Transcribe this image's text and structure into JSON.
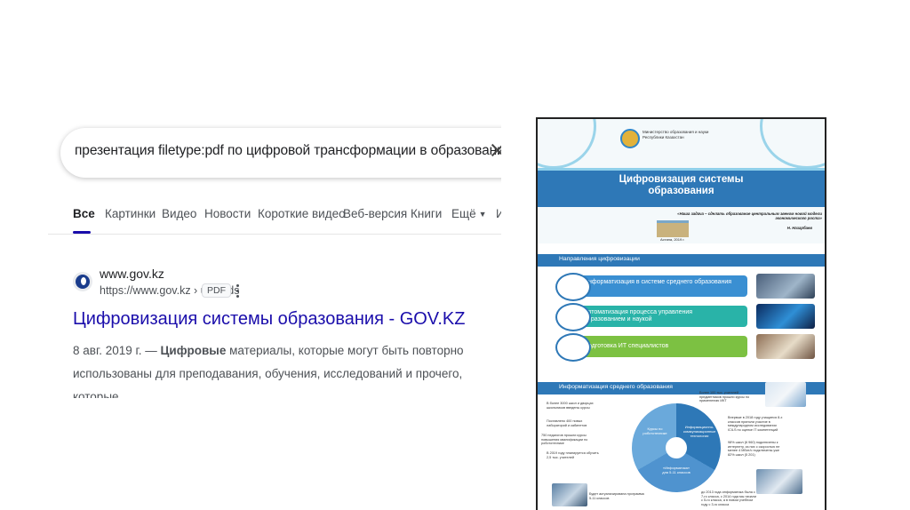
{
  "search": {
    "query": "презентация filetype:pdf по цифровой трансформации в образовании site:gov.kz",
    "tabs": [
      "Все",
      "Картинки",
      "Видео",
      "Новости",
      "Короткие видео",
      "Веб-версия",
      "Книги",
      "Ещё"
    ],
    "tab_overflow": "И"
  },
  "result": {
    "site_name": "www.gov.kz",
    "url": "https://www.gov.kz › uploads",
    "badge": "PDF",
    "title": "Цифровизация системы образования - GOV.KZ",
    "snippet_date": "8 авг. 2019 г. — ",
    "snippet_bold": "Цифровые",
    "snippet_rest": " материалы, которые могут быть повторно использованы для преподавания, обучения, исследований и прочего, которые."
  },
  "slide": {
    "ministry": "Министерство образования и науки Республики Казахстан",
    "title_line1": "Цифровизация системы",
    "title_line2": "образования",
    "quote": "«Наша задача – сделать образование центральным звеном новой модели экономического роста»",
    "author": "Н. Назарбаев",
    "city": "Астана, 2019 г.",
    "section2_header": "Направления цифровизации",
    "directions": [
      "Информатизация в системе среднего образования",
      "Автоматизация процесса управления образованием и наукой",
      "Подготовка ИТ специалистов"
    ],
    "section3_header": "Информатизация среднего образования",
    "donut_labels": [
      "Курсы по робототехнике",
      "Информационно-коммуникационные технологии",
      "«Информатика» для 5-11 классов"
    ],
    "notes_left": [
      "В более 3000 школ и дворцах школьников введены курсы",
      "Поставлено 400 новых лабораторий и кабинетов",
      "750 педагогов прошли курсы повышения квалификации по робототехнике",
      "В 2019 году планируется обучить 2,5 тыс. учителей"
    ],
    "notes_right": [
      "Более 100 тыс. учителей предметников прошли курсы по применению ИКТ",
      "Впервые в 2018 году учащиеся 8-х классов приняли участие в международном исследовании ICILS по оценке IT компетенций",
      "98% школ (6 960) подключены к интернету, из них с скоростью не менее 4 Мбит/с подключены уже 82% школ (5 201)",
      "до 2013 года информатика была с 7-го класса, с 2014 года мы начали с 5-го класса, а в новом учебном году с 3-го класса"
    ],
    "note_bottom": "Будет актуализирована программа 5-11 классов"
  },
  "colors": {
    "link": "#1a0dab",
    "slide_blue": "#2e78b7",
    "bar_blue": "#3a8fd2",
    "bar_teal": "#29b3a8",
    "bar_green": "#7cc142"
  }
}
